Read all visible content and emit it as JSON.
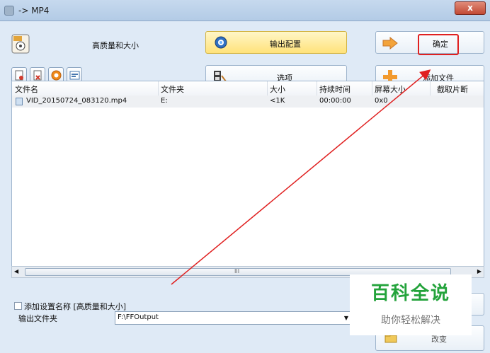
{
  "window": {
    "title": "-> MP4",
    "close_label": "x"
  },
  "toolbar": {
    "quality_label": "高质量和大小",
    "output_config_label": "输出配置",
    "options_label": "选项",
    "confirm_label": "确定",
    "add_file_label": "添加文件"
  },
  "table": {
    "headers": [
      "文件名",
      "文件夹",
      "大小",
      "持续时间",
      "屏幕大小",
      "截取片断"
    ],
    "rows": [
      {
        "name": "VID_20150724_083120.mp4",
        "folder": "E:",
        "size": "<1K",
        "duration": "00:00:00",
        "screen": "0x0",
        "clip": ""
      }
    ]
  },
  "scrollbar": {
    "middle_grip": "III"
  },
  "settings": {
    "add_setting_name_label": "添加设置名称 [高质量和大小]",
    "output_folder_label": "输出文件夹",
    "output_folder_value": "F:\\FFOutput",
    "change_label": "改变"
  },
  "watermark": {
    "title": "百科全说",
    "subtitle": "助你轻松解决"
  },
  "colors": {
    "accent_green": "#23a33b",
    "highlight_red": "#e02020"
  }
}
